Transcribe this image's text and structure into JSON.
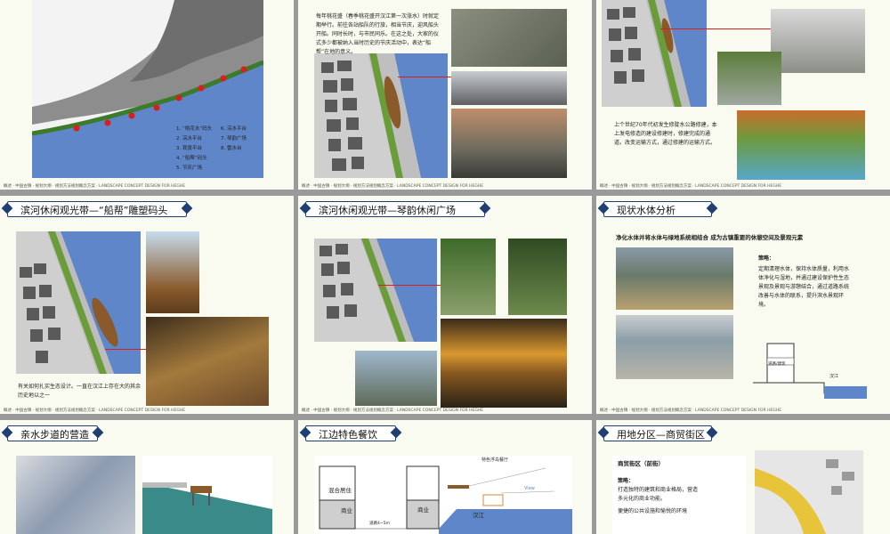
{
  "slides": {
    "s1": {
      "legend_col1": [
        "1. “桃花水”码头",
        "2. 浣水平台",
        "3. 观景平台",
        "4. “船帮”码头",
        "5. 节庆广场"
      ],
      "legend_col2": [
        "6. 浣水平台",
        "7. 琴韵广场",
        "8. 雷水台"
      ]
    },
    "s2": {
      "text": "每年桃花盛（春季桃花盛开汉江第一次涨水）时就定期举行。前往各站船队的行旅，相当节庆，迎风船头开船。同时长时，与市民同乐。在这之处，大家的仪式多少都被纳入当时历史的节庆活动中，表达“船帮”在地的意义。"
    },
    "s3": {
      "text": "上个世纪70年代初发生修陡水公路修建，本上发电修造的建设修建时，修建完成的通道。改变运输方式，通过修建的运输方式。"
    },
    "s4": {
      "title": "滨河休闲观光带—“船帮”雕塑码头",
      "text": "有关如何扎实生态设计。一直在汉江上存在大的其余历史地以之一"
    },
    "s5": {
      "title": "滨河休闲观光带—琴韵休闲广场"
    },
    "s6": {
      "title": "现状水体分析",
      "heading": "净化水体并将水体与绿地系统相结合 成为古镇重要的休憩空间及景观元素",
      "strategy_label": "策略：",
      "strategy_text": "定期清理水体，保持水体质量，利用水体净化与湿地，并通过建设保护性生态景观及景观与游憩结合，通过道路系统改善与水体的联系，提升滨水景观环境。",
      "diagram_label": "道路/建筑",
      "water_label": "汉江"
    },
    "s7": {
      "title": "亲水步道的营造"
    },
    "s8": {
      "title": "江边特色餐饮",
      "label_floating": "特色浮岛餐厅",
      "label_view": "View",
      "label_mixed": "混合居住",
      "label_commerce1": "商业",
      "label_commerce2": "商业",
      "label_river": "汉江",
      "label_width": "道路4~5m"
    },
    "s9": {
      "title": "用地分区—商贸街区",
      "box_title": "商贸街区（前街）",
      "strategy_label": "策略：",
      "strategy_lines": [
        "打造独特的建筑和商业格局，营造",
        "多元化的商业功能。",
        "",
        "便捷的公共设施和愉悦的环境"
      ]
    },
    "footer": "概述 · 中国古镇 · 规划大纲 · 规划方法规划概念方案 · LANDSCAPE CONCEPT DESIGN FOR HEGHE"
  },
  "colors": {
    "header_border": "#1f3f73",
    "river": "#5f86c9",
    "accent_red": "#d81f1f",
    "slide_bg": "#f9fbf0"
  }
}
